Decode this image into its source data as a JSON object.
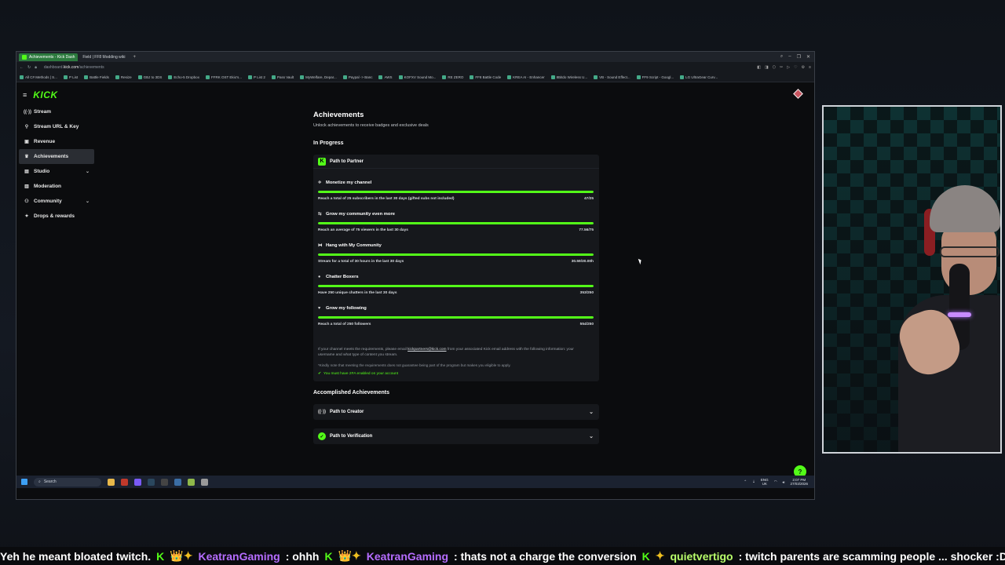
{
  "browser": {
    "tabs": [
      {
        "label": "Achievements - Kick Dash",
        "active": true
      },
      {
        "label": "Field | FF8 Modding wiki",
        "active": false
      }
    ],
    "new_tab": "+",
    "url_prefix": "dashboard.",
    "url_domain": "kick.com",
    "url_path": "/achievements",
    "bookmarks": [
      "All C# Methods | S...",
      "P List",
      "Battle Fields",
      "Resize",
      "GBJ to 3DS",
      "Echo-5 Dropbox",
      "FFRK OST Ekio's...",
      "P List 2",
      "Pass Vault",
      "MyWelfare, Depar...",
      "Paypal -> Banc",
      "AWS",
      "KOFXV Sound Mo...",
      "RE ZERO",
      "FF8 Battle Code",
      "KREA AI - Enhancer",
      "8Bitdo Wireless U...",
      "VB - Sound Effect...",
      "FF9 Script - Googl...",
      "LG UltraGear Curv..."
    ]
  },
  "sidebar": {
    "logo": "KICK",
    "items": [
      {
        "label": "Stream",
        "icon": "((·))"
      },
      {
        "label": "Stream URL & Key",
        "icon": "⚲"
      },
      {
        "label": "Revenue",
        "icon": "▣"
      },
      {
        "label": "Achievements",
        "icon": "♛"
      },
      {
        "label": "Studio",
        "icon": "▤"
      },
      {
        "label": "Moderation",
        "icon": "▥"
      },
      {
        "label": "Community",
        "icon": "⚇"
      },
      {
        "label": "Drops & rewards",
        "icon": "✦"
      }
    ]
  },
  "main": {
    "title": "Achievements",
    "subtitle": "Unlock achievements to receive badges and exclusive deals",
    "in_progress": "In Progress",
    "card_title": "Path to Partner",
    "goals": [
      {
        "title": "Monetize my channel",
        "icon": "✈",
        "desc": "Reach a total of 25 subscribers in the last 30 days (gifted subs not included)",
        "value": "47/25",
        "progress": 1.0
      },
      {
        "title": "Grow my community even more",
        "icon": "⇆",
        "desc": "Reach an average of 75 viewers in the last 30 days",
        "value": "77.56/75",
        "progress": 1.0
      },
      {
        "title": "Hang with My Community",
        "icon": "⧓",
        "desc": "Stream for a total of 30 hours in the last 30 days",
        "value": "30.59/30.00h",
        "progress": 1.0
      },
      {
        "title": "Chatter Boxers",
        "icon": "●",
        "desc": "Have 250 unique chatters in the last 30 days",
        "value": "353/250",
        "progress": 1.0
      },
      {
        "title": "Grow my following",
        "icon": "♥",
        "desc": "Reach a total of 250 followers",
        "value": "554/250",
        "progress": 1.0
      }
    ],
    "note_before": "If your channel meets the requirements, please email ",
    "note_link": "kickpartners@kick.com",
    "note_after": " from your associated Kick email address with the following information: your username and what type of content you stream.",
    "note2": "*Kindly note that meeting the requirements does not guarantee being part of the program but makes you eligible to apply.",
    "check_text": "You must have 2FA enabled on your account",
    "accomplished": "Accomplished Achievements",
    "accordions": [
      {
        "label": "Path to Creator"
      },
      {
        "label": "Path to Verification"
      }
    ]
  },
  "taskbar": {
    "search": "Search",
    "lang_top": "ENG",
    "lang_bottom": "UK",
    "time": "2:07 PM",
    "date": "27/03/2026"
  },
  "ticker": {
    "segments": [
      {
        "type": "text",
        "text": "Yeh he meant bloated twitch."
      },
      {
        "type": "k",
        "text": "K"
      },
      {
        "type": "badge",
        "text": "👑✦"
      },
      {
        "type": "user",
        "text": "KeatranGaming"
      },
      {
        "type": "text",
        "text": ": ohhh"
      },
      {
        "type": "k",
        "text": "K"
      },
      {
        "type": "badge",
        "text": "👑✦"
      },
      {
        "type": "user",
        "text": "KeatranGaming"
      },
      {
        "type": "text",
        "text": ": thats not a charge the conversion"
      },
      {
        "type": "k",
        "text": "K"
      },
      {
        "type": "badge",
        "text": "✦"
      },
      {
        "type": "user2",
        "text": "quietvertigo"
      },
      {
        "type": "text",
        "text": ": twitch parents are scamming people ... shocker :D"
      }
    ]
  },
  "colors": {
    "accent": "#53fc18",
    "bg": "#0b0c0e",
    "card": "#16181c"
  }
}
